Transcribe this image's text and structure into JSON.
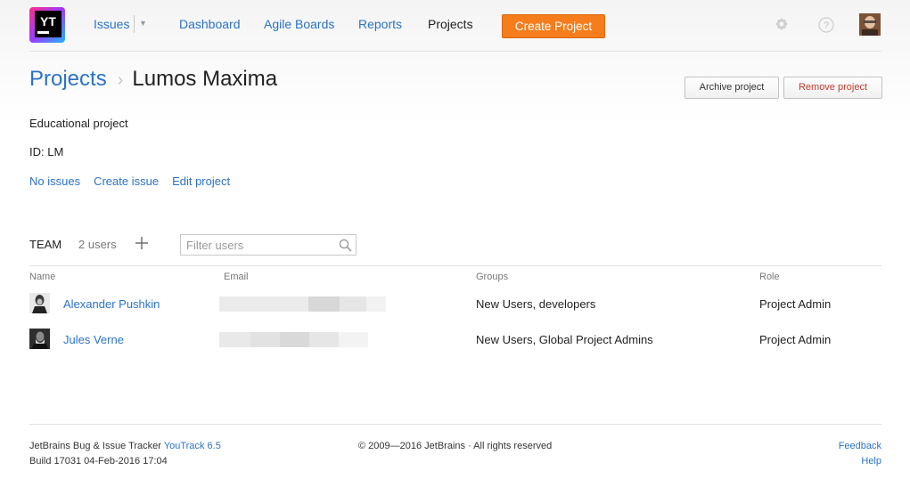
{
  "nav": {
    "logo_text": "YT",
    "items": [
      {
        "label": "Issues"
      },
      {
        "label": "Dashboard"
      },
      {
        "label": "Agile Boards"
      },
      {
        "label": "Reports"
      },
      {
        "label": "Projects"
      }
    ],
    "create_label": "Create Project",
    "accent_color": "#f57d1c"
  },
  "breadcrumb": {
    "root": "Projects",
    "separator": "›",
    "current": "Lumos Maxima"
  },
  "actions": {
    "archive": "Archive project",
    "remove": "Remove project"
  },
  "project": {
    "description": "Educational project",
    "id": "ID: LM",
    "links": [
      "No issues",
      "Create issue",
      "Edit project"
    ]
  },
  "team": {
    "label": "TEAM",
    "count": "2 users",
    "filter_placeholder": "Filter users",
    "columns": [
      "Name",
      "Email",
      "Groups",
      "Role"
    ],
    "rows": [
      {
        "name": "Alexander Pushkin",
        "groups": "New Users, developers",
        "role": "Project Admin"
      },
      {
        "name": "Jules Verne",
        "groups": "New Users, Global Project Admins",
        "role": "Project Admin"
      }
    ]
  },
  "footer": {
    "tracker_prefix": "JetBrains Bug & Issue Tracker",
    "tracker_link": "YouTrack 6.5",
    "build": "Build 17031 04-Feb-2016 17:04",
    "copyright": "© 2009—2016 JetBrains · All rights reserved",
    "feedback": "Feedback",
    "help": "Help"
  },
  "icons": [
    "gear-icon",
    "help-icon",
    "plus-icon",
    "search-icon",
    "chevron-down-icon"
  ]
}
